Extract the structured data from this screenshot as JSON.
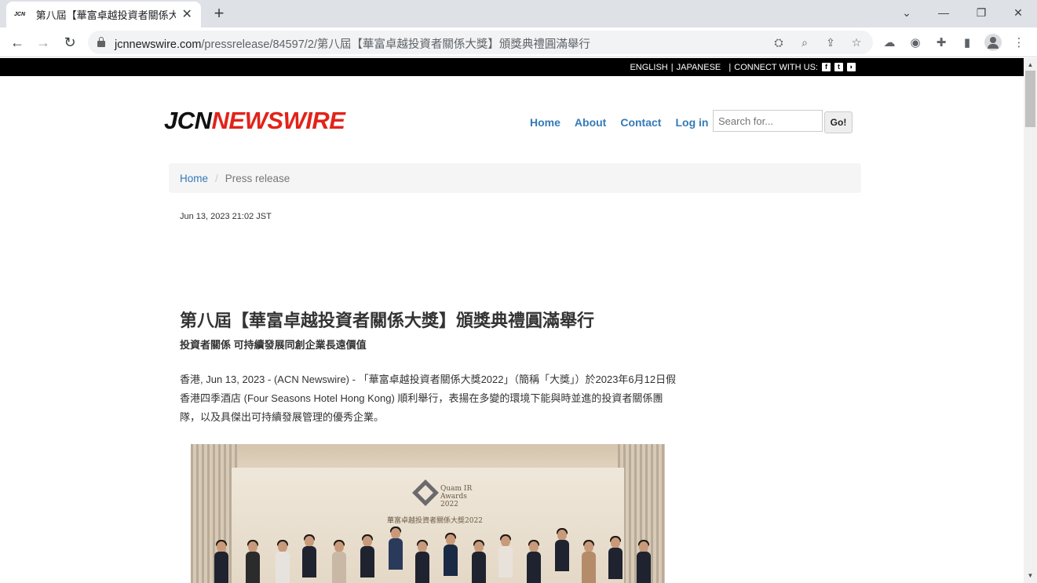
{
  "browser": {
    "tab_title": "第八屆【華富卓越投資者關係大獎】頒獎典禮圓滿舉行",
    "tab_favicon_text": "JCN",
    "url_host": "jcnnewswire.com",
    "url_path": "/pressrelease/84597/2/第八屆【華富卓越投資者關係大獎】頒獎典禮圓滿舉行"
  },
  "topbar": {
    "english": "ENGLISH",
    "japanese": "JAPANESE",
    "connect": "CONNECT WITH US:"
  },
  "logo": {
    "part1": "JCN",
    "part2": "NEWSWIRE"
  },
  "nav": {
    "home": "Home",
    "about": "About",
    "contact": "Contact",
    "login": "Log in"
  },
  "search": {
    "placeholder": "Search for...",
    "go": "Go!"
  },
  "breadcrumb": {
    "home": "Home",
    "current": "Press release"
  },
  "article": {
    "date": "Jun 13, 2023 21:02 JST",
    "title": "第八屆【華富卓越投資者關係大獎】頒獎典禮圓滿舉行",
    "subtitle": "投資者關係 可持續發展同創企業長遠價值",
    "dateline": "香港, Jun 13, 2023 - (ACN Newswire) - ",
    "body": "「華富卓越投資者關係大獎2022」（簡稱「大獎」）於2023年6月12日假香港四季酒店 (Four Seasons Hotel Hong Kong) 順利舉行，表揚在多變的環境下能與時並進的投資者關係團隊，以及具傑出可持續發展管理的優秀企業。"
  },
  "photo": {
    "award_line1": "Quam IR",
    "award_line2": "Awards",
    "award_line3": "2022",
    "award_cn": "華富卓越投資者關係大獎2022"
  }
}
